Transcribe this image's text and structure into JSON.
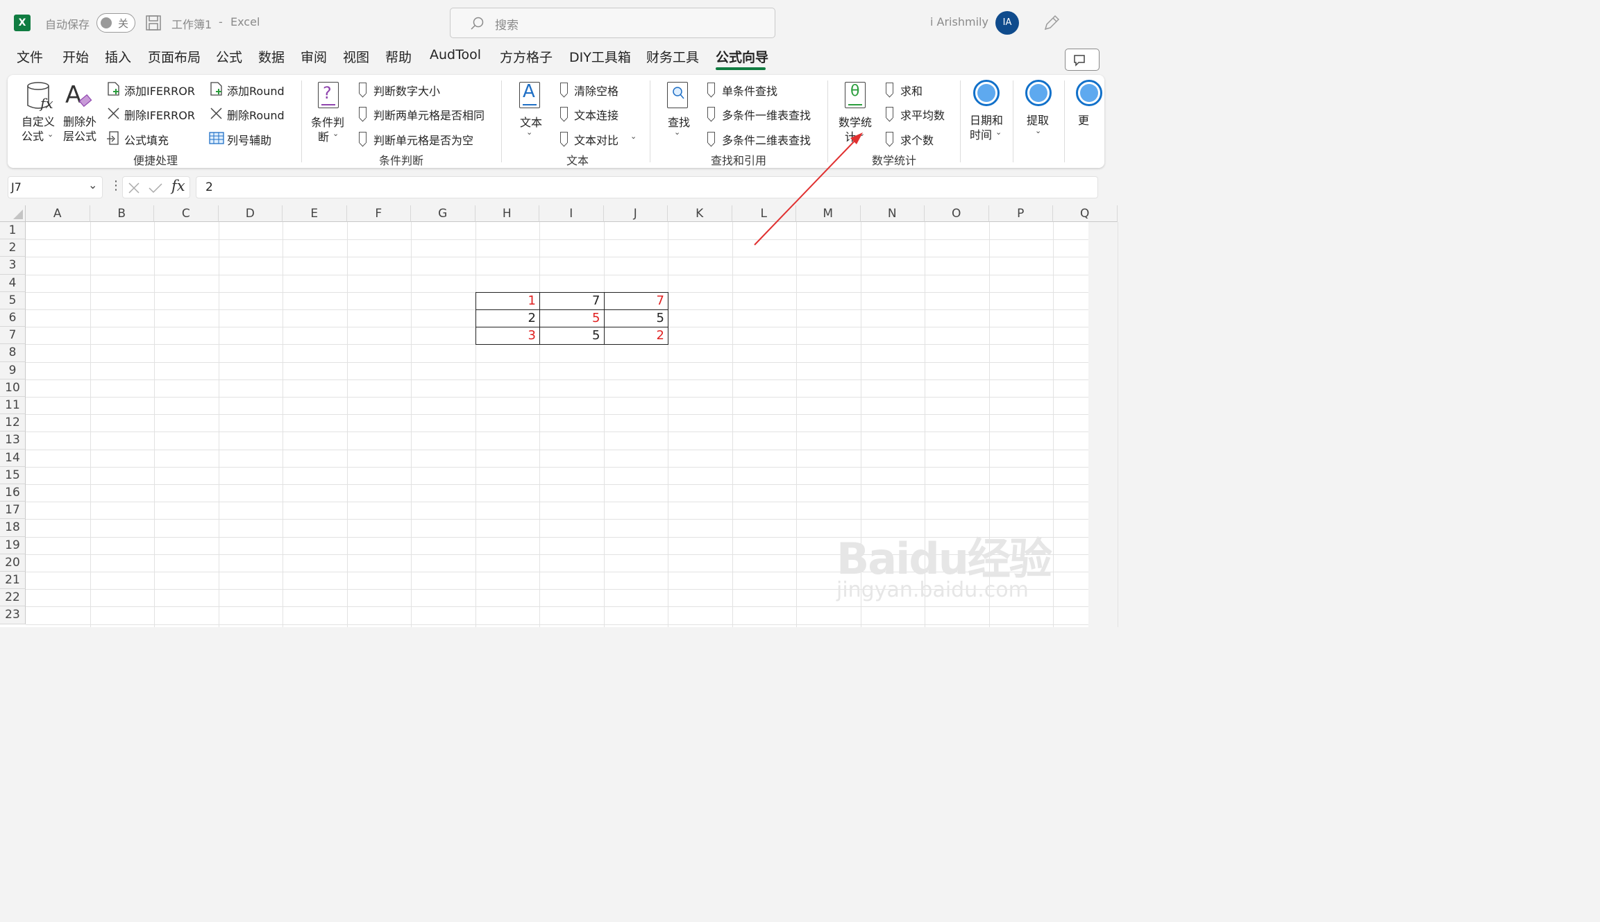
{
  "titlebar": {
    "app_logo": "X",
    "autosave_label": "自动保存",
    "autosave_state": "关",
    "document_title": "工作簿1",
    "separator": "-",
    "app_name": "Excel",
    "search_placeholder": "搜索",
    "user_name": "i Arishmily",
    "user_initials": "IA"
  },
  "tabs": [
    "文件",
    "开始",
    "插入",
    "页面布局",
    "公式",
    "数据",
    "审阅",
    "视图",
    "帮助",
    "AudTool",
    "方方格子",
    "DIY工具箱",
    "财务工具",
    "公式向导"
  ],
  "active_tab": "公式向导",
  "ribbon": {
    "quick": {
      "custom_formula_line1": "自定义",
      "custom_formula_line2": "公式",
      "delete_outer_line1": "删除外",
      "delete_outer_line2": "层公式",
      "add_iferror": "添加IFERROR",
      "del_iferror": "删除IFERROR",
      "formula_fill": "公式填充",
      "add_round": "添加Round",
      "del_round": "删除Round",
      "col_helper": "列号辅助",
      "group_label": "便捷处理"
    },
    "cond": {
      "big_line1": "条件判",
      "big_line2": "断",
      "item1": "判断数字大小",
      "item2": "判断两单元格是否相同",
      "item3": "判断单元格是否为空",
      "group_label": "条件判断"
    },
    "text": {
      "big": "文本",
      "item1": "清除空格",
      "item2": "文本连接",
      "item3": "文本对比",
      "group_label": "文本"
    },
    "lookup": {
      "big": "查找",
      "item1": "单条件查找",
      "item2": "多条件一维表查找",
      "item3": "多条件二维表查找",
      "group_label": "查找和引用"
    },
    "math": {
      "big_line1": "数学统",
      "big_line2": "计",
      "item1": "求和",
      "item2": "求平均数",
      "item3": "求个数",
      "group_label": "数学统计"
    },
    "date": {
      "line1": "日期和",
      "line2": "时间"
    },
    "extract": {
      "label": "提取"
    },
    "more": {
      "label": "更"
    }
  },
  "formula_bar": {
    "name_box": "J7",
    "fx": "fx",
    "value": "2"
  },
  "columns": [
    "A",
    "B",
    "C",
    "D",
    "E",
    "F",
    "G",
    "H",
    "I",
    "J",
    "K",
    "L",
    "M",
    "N",
    "O",
    "P",
    "Q"
  ],
  "rows": [
    "1",
    "2",
    "3",
    "4",
    "5",
    "6",
    "7",
    "8",
    "9",
    "10",
    "11",
    "12",
    "13",
    "14",
    "15",
    "16",
    "17",
    "18",
    "19",
    "20",
    "21",
    "22",
    "23"
  ],
  "table": [
    [
      {
        "v": "1",
        "color": "#e02020"
      },
      {
        "v": "7",
        "color": "#222222"
      },
      {
        "v": "7",
        "color": "#e02020"
      }
    ],
    [
      {
        "v": "2",
        "color": "#222222"
      },
      {
        "v": "5",
        "color": "#e02020"
      },
      {
        "v": "5",
        "color": "#222222"
      }
    ],
    [
      {
        "v": "3",
        "color": "#e02020"
      },
      {
        "v": "5",
        "color": "#222222"
      },
      {
        "v": "2",
        "color": "#e02020"
      }
    ]
  ],
  "watermark": {
    "brand": "Baidu经验",
    "url": "jingyan.baidu.com"
  },
  "colors": {
    "accent": "#117c41",
    "annotation_arrow": "#e03030",
    "red_text": "#e02020"
  }
}
